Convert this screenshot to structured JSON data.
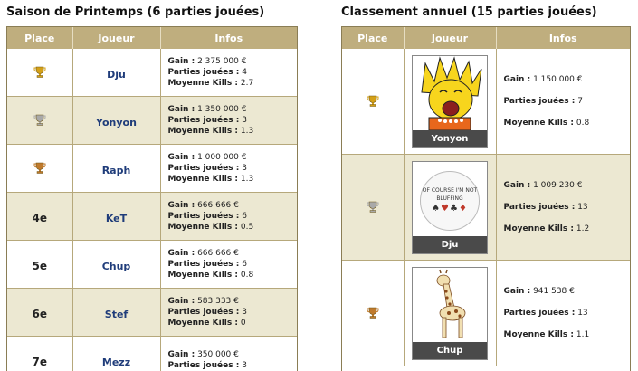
{
  "left": {
    "title": "Saison de Printemps (6 parties jouées)",
    "headers": {
      "place": "Place",
      "player": "Joueur",
      "infos": "Infos"
    },
    "labels": {
      "gain": "Gain :",
      "played": "Parties jouées :",
      "kills": "Moyenne Kills :"
    },
    "rows": [
      {
        "rank_icon": "gold-trophy-icon",
        "rank_text": "",
        "player": "Dju",
        "gain": "2 375 000 €",
        "played": "4",
        "kills": "2.7"
      },
      {
        "rank_icon": "silver-trophy-icon",
        "rank_text": "",
        "player": "Yonyon",
        "gain": "1 350 000 €",
        "played": "3",
        "kills": "1.3"
      },
      {
        "rank_icon": "bronze-trophy-icon",
        "rank_text": "",
        "player": "Raph",
        "gain": "1 000 000 €",
        "played": "3",
        "kills": "1.3"
      },
      {
        "rank_icon": "",
        "rank_text": "4e",
        "player": "KeT",
        "gain": "666 666 €",
        "played": "6",
        "kills": "0.5"
      },
      {
        "rank_icon": "",
        "rank_text": "5e",
        "player": "Chup",
        "gain": "666 666 €",
        "played": "6",
        "kills": "0.8"
      },
      {
        "rank_icon": "",
        "rank_text": "6e",
        "player": "Stef",
        "gain": "583 333 €",
        "played": "3",
        "kills": "0"
      },
      {
        "rank_icon": "",
        "rank_text": "7e",
        "player": "Mezz",
        "gain": "350 000 €",
        "played": "3",
        "kills": ""
      }
    ]
  },
  "right": {
    "title": "Classement annuel (15 parties jouées)",
    "headers": {
      "place": "Place",
      "player": "Joueur",
      "infos": "Infos"
    },
    "labels": {
      "gain": "Gain :",
      "played": "Parties jouées :",
      "kills": "Moyenne Kills :"
    },
    "rows": [
      {
        "rank_icon": "gold-trophy-icon",
        "player": "Yonyon",
        "avatar": "yelling-cartoon-girl-avatar",
        "gain": "1 150 000 €",
        "played": "7",
        "kills": "0.8"
      },
      {
        "rank_icon": "silver-trophy-icon",
        "player": "Dju",
        "avatar": "poker-badge-avatar",
        "badge_text": "OF COURSE I'M NOT BLUFFING",
        "gain": "1 009 230 €",
        "played": "13",
        "kills": "1.2"
      },
      {
        "rank_icon": "bronze-trophy-icon",
        "player": "Chup",
        "avatar": "toy-giraffe-avatar",
        "gain": "941 538 €",
        "played": "13",
        "kills": "1.1"
      }
    ]
  },
  "colors": {
    "header_bg": "#bfae7e",
    "row_alt_bg": "#ece8d2",
    "player_name": "#1f3c7a",
    "gold": "#d4a017",
    "silver": "#a9a9a9",
    "bronze": "#c07a2c"
  }
}
